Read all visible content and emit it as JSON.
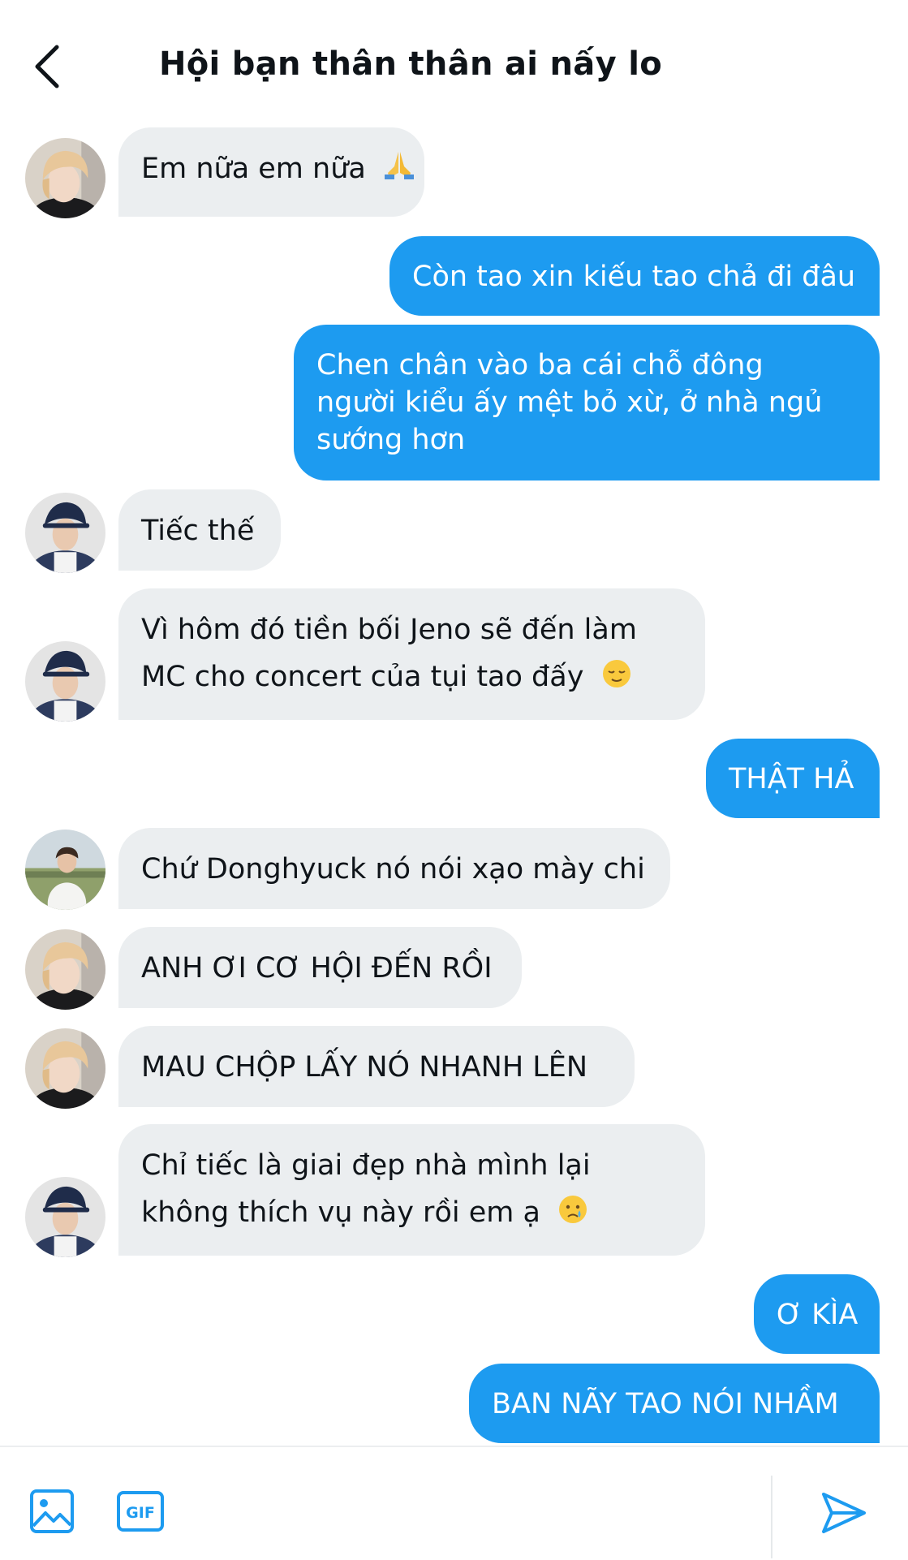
{
  "header": {
    "title": "Hội bạn thân thân ai nấy lo"
  },
  "messages": [
    {
      "side": "in",
      "avatar": "avatar-1",
      "text": "Em nữa em nữa"
    },
    {
      "side": "out",
      "text": "Còn tao xin kiếu tao chả đi đâu"
    },
    {
      "side": "out",
      "lines": [
        "Chen chân vào ba cái chỗ đông",
        "người kiểu ấy mệt bỏ xừ, ở nhà ngủ",
        "sướng hơn"
      ]
    },
    {
      "side": "in",
      "avatar": "avatar-2",
      "text": "Tiếc thế"
    },
    {
      "side": "in",
      "avatar": "avatar-2",
      "lines": [
        "Vì hôm đó tiền bối Jeno sẽ đến làm",
        "MC cho concert của tụi tao đấy"
      ]
    },
    {
      "side": "out",
      "text": "THẬT HẢ"
    },
    {
      "side": "in",
      "avatar": "avatar-3",
      "text": "Chứ Donghyuck nó nói xạo mày chi"
    },
    {
      "side": "in",
      "avatar": "avatar-1",
      "text": "ANH ƠI CƠ HỘI ĐẾN RỒI"
    },
    {
      "side": "in",
      "avatar": "avatar-1",
      "text": "MAU CHỘP LẤY NÓ NHANH LÊN"
    },
    {
      "side": "in",
      "avatar": "avatar-2",
      "lines": [
        "Chỉ tiếc là giai đẹp nhà mình lại",
        "không thích vụ này rồi em ạ"
      ]
    },
    {
      "side": "out",
      "text": "Ơ KÌA"
    },
    {
      "side": "out",
      "text": "BAN NÃY TAO NÓI NHẦM"
    }
  ],
  "icons": {
    "back": "chevron-left-icon",
    "image": "image-icon",
    "gif": "gif-icon",
    "send": "send-icon",
    "emoji_pray": "folded-hands-emoji",
    "emoji_relieved": "relieved-face-emoji",
    "emoji_cry": "crying-face-emoji"
  },
  "composer": {
    "gif_label": "GIF"
  },
  "colors": {
    "accent": "#1d9bf0",
    "incoming_bubble": "#ebeef0",
    "text": "#0f1419"
  }
}
